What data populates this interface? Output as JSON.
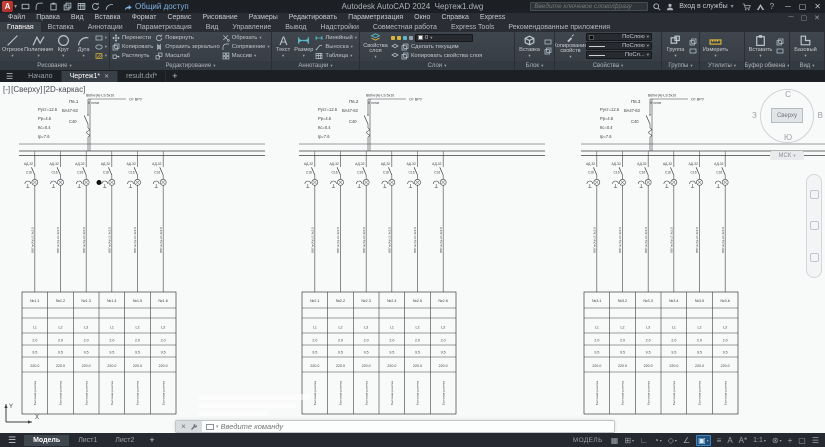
{
  "titlebar": {
    "logo": "A",
    "share_label": "Общий доступ",
    "title": "Autodesk AutoCAD 2024",
    "doc": "Чертеж1.dwg",
    "search_placeholder": "Введите ключевое слово/фразу",
    "signin_label": "Вход в службы"
  },
  "menu": {
    "items": [
      "Файл",
      "Правка",
      "Вид",
      "Вставка",
      "Формат",
      "Сервис",
      "Рисование",
      "Размеры",
      "Редактировать",
      "Параметризация",
      "Окно",
      "Справка",
      "Express"
    ]
  },
  "ribbon": {
    "active_tab": "Главная",
    "tabs": [
      "Главная",
      "Вставка",
      "Аннотации",
      "Параметризация",
      "Вид",
      "Управление",
      "Вывод",
      "Надстройки",
      "Совместная работа",
      "Express Tools",
      "Рекомендованные приложения"
    ],
    "panels": [
      {
        "name": "Рисование",
        "type": "draw",
        "width": 110,
        "big": [
          {
            "label": "Отрезок",
            "icon": "line"
          },
          {
            "label": "Полилиния",
            "icon": "polyline"
          },
          {
            "label": "Круг",
            "icon": "circle"
          },
          {
            "label": "Дуга",
            "icon": "arc"
          }
        ],
        "small": [
          {
            "icon": "rect"
          },
          {
            "icon": "ellipse"
          },
          {
            "icon": "hatch"
          }
        ]
      },
      {
        "name": "Редактирование",
        "type": "modify",
        "width": 162,
        "cols": [
          [
            {
              "label": "Перенести",
              "icon": "move"
            },
            {
              "label": "Копировать",
              "icon": "copy"
            },
            {
              "label": "Растянуть",
              "icon": "stretch"
            }
          ],
          [
            {
              "label": "Повернуть",
              "icon": "rotate"
            },
            {
              "label": "Отразить зеркально",
              "icon": "mirror"
            },
            {
              "label": "Масштаб",
              "icon": "scale"
            }
          ],
          [
            {
              "label": "Обрезать",
              "icon": "trim"
            },
            {
              "label": "Сопряжение",
              "icon": "fillet"
            },
            {
              "label": "Массив",
              "icon": "array"
            }
          ]
        ]
      },
      {
        "name": "Аннотации",
        "type": "annot",
        "width": 88,
        "big": [
          {
            "label": "Текст",
            "icon": "text"
          },
          {
            "label": "Размер",
            "icon": "dim"
          }
        ],
        "rows": [
          {
            "label": "Линейный",
            "icon": "dim"
          },
          {
            "label": "Выноска",
            "icon": "leader"
          },
          {
            "label": "Таблица",
            "icon": "table"
          }
        ]
      },
      {
        "name": "Слои",
        "type": "layers",
        "width": 155,
        "big": [
          {
            "label": "Свойства слоя",
            "icon": "layerprops"
          }
        ],
        "layer_value": "0",
        "rows": [
          {
            "label": "Сделать текущим",
            "icon": "layer"
          },
          {
            "label": "Копировать свойства слоя",
            "icon": "layer"
          }
        ]
      },
      {
        "name": "Блок",
        "type": "block",
        "width": 40,
        "big": [
          {
            "label": "Вставка",
            "icon": "insert"
          }
        ],
        "small": [
          {
            "icon": "rect"
          },
          {
            "icon": "copy"
          }
        ]
      },
      {
        "name": "Свойства",
        "type": "props",
        "width": 107,
        "big": [
          {
            "label": "Копирование свойств",
            "icon": "matchprops"
          }
        ],
        "dropdowns": [
          "ПоСлою",
          "ПоСлою",
          "ПоСл..."
        ]
      },
      {
        "name": "Группы",
        "type": "groups",
        "width": 38,
        "big": [
          {
            "label": "Группа",
            "icon": "group"
          }
        ],
        "small": [
          {
            "icon": "copy"
          },
          {
            "icon": "rect"
          }
        ]
      },
      {
        "name": "Утилиты",
        "type": "utils",
        "width": 45,
        "big": [
          {
            "label": "Измерить",
            "icon": "measure"
          }
        ]
      },
      {
        "name": "Буфер обмена",
        "type": "clipboard",
        "width": 45,
        "big": [
          {
            "label": "Вставить",
            "icon": "paste"
          }
        ],
        "small": [
          {
            "icon": "copy"
          },
          {
            "icon": "rect"
          }
        ]
      },
      {
        "name": "Вид",
        "type": "view",
        "width": 35,
        "big": [
          {
            "label": "Базовый",
            "icon": "baseview"
          }
        ]
      }
    ]
  },
  "file_tabs": {
    "tabs": [
      {
        "label": "Начало",
        "active": false,
        "closable": false
      },
      {
        "label": "Чертеж1*",
        "active": true,
        "closable": true
      },
      {
        "label": "result.dxf*",
        "active": false,
        "closable": false
      }
    ],
    "new_tab": "+"
  },
  "viewport": {
    "minus": "[-]",
    "view": "[Сверху]",
    "visual": "[2D-каркас]"
  },
  "viewcube": {
    "n": "С",
    "s": "Ю",
    "w": "З",
    "e": "В",
    "top": "Сверху",
    "ucs": "МСК"
  },
  "drawing": {
    "groups": [
      {
        "name": "Пв.1",
        "params": [
          "Руст=12.6",
          "Рр=4.6",
          "Кс=0.4",
          "Iр=7.6"
        ],
        "breaker": "ВА47-63",
        "rating": "С40",
        "feeder_cable": "ВВГнг(А)-LS 5х10",
        "feeder_note": "В лотке",
        "source": "От ВРУ",
        "branch_label": "АД-32",
        "branch_rating": "С16",
        "branch_cable": "ВВГнг(А)-LS 3х2.5",
        "cursor_dot": true,
        "table": {
          "headers": [
            "№1.1",
            "№1.2",
            "№1.3",
            "№1.4",
            "№1.5",
            "№1.6"
          ],
          "phases": [
            "L1",
            "L2",
            "L3",
            "L1",
            "L2",
            "L3"
          ],
          "power": "2.0",
          "current": "9.5",
          "voltage": "220.0",
          "load": "Бытовая розетка"
        }
      },
      {
        "name": "Пв.2",
        "params": [
          "Руст=12.6",
          "Рр=4.6",
          "Кс=0.4",
          "Iр=7.6"
        ],
        "breaker": "ВА47-63",
        "rating": "С40",
        "feeder_cable": "ВВГнг(А)-LS 5х10",
        "feeder_note": "В лотке",
        "source": "От ВРУ",
        "branch_label": "АД-32",
        "branch_rating": "С16",
        "branch_cable": "ВВГнг(А)-LS 3х2.5",
        "cursor_dot": false,
        "table": {
          "headers": [
            "№2.1",
            "№2.2",
            "№2.3",
            "№2.4",
            "№2.5",
            "№2.6"
          ],
          "phases": [
            "L1",
            "L2",
            "L3",
            "L1",
            "L2",
            "L3"
          ],
          "power": "2.0",
          "current": "9.5",
          "voltage": "220.0",
          "load": "Бытовая розетка"
        }
      },
      {
        "name": "Пв.3",
        "params": [
          "Руст=12.6",
          "Рр=4.6",
          "Кс=0.4",
          "Iр=7.6"
        ],
        "breaker": "ВА47-63",
        "rating": "С40",
        "feeder_cable": "ВВГнг(А)-LS 5х10",
        "feeder_note": "В лотке",
        "source": "От ВРУ",
        "branch_label": "АД-32",
        "branch_rating": "С16",
        "branch_cable": "ВВГнг(А)-LS 3х2.5",
        "cursor_dot": false,
        "table": {
          "headers": [
            "№3.1",
            "№3.2",
            "№3.3",
            "№3.4",
            "№3.5",
            "№3.6"
          ],
          "phases": [
            "L1",
            "L2",
            "L3",
            "L1",
            "L2",
            "L3"
          ],
          "power": "2.0",
          "current": "9.5",
          "voltage": "220.0",
          "load": "Бытовая розетка"
        }
      }
    ],
    "group_x": [
      18,
      298,
      580
    ]
  },
  "command_line": {
    "placeholder": "Введите команду"
  },
  "layout_tabs": {
    "items": [
      "Модель",
      "Лист1",
      "Лист2"
    ],
    "active": "Модель",
    "new_tab": "+"
  },
  "status_bar": {
    "model_label": "МОДЕЛЬ",
    "scale_label": "1:1",
    "icons": [
      "grid",
      "snap",
      "ortho",
      "polar",
      "isodraft",
      "otrack",
      "osnap",
      "lineweight",
      "annotation-visibility",
      "annotation-autoscale",
      "annotation-scale",
      "customization-gear",
      "add",
      "clean-screen",
      "menu"
    ]
  },
  "colors": {
    "accent_blue": "#1d4f79",
    "canvas": "#f8f9f9",
    "line": "#3b3e42",
    "ribbon_bg": "#3a4047"
  }
}
